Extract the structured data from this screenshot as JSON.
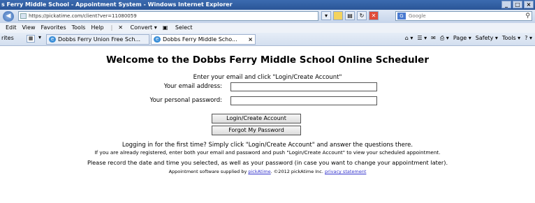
{
  "window": {
    "title": "s Ferry Middle School - Appointment System - Windows Internet Explorer",
    "buttons": [
      "_",
      "□",
      "×"
    ]
  },
  "address_bar": {
    "url": "https://pickatime.com/client?ver=11080059",
    "search_placeholder": "Google"
  },
  "menu": {
    "items": [
      "Edit",
      "View",
      "Favorites",
      "Tools",
      "Help"
    ],
    "extras": [
      "Convert",
      "Select"
    ]
  },
  "tabbar": {
    "favorites_label": "rites",
    "tabs": [
      {
        "label": "Dobbs Ferry Union Free Sch..."
      },
      {
        "label": "Dobbs Ferry Middle Scho..."
      }
    ],
    "commands": [
      "Page ▾",
      "Safety ▾",
      "Tools ▾"
    ]
  },
  "page": {
    "heading": "Welcome to the Dobbs Ferry Middle School Online Scheduler",
    "instruction": "Enter your email and click \"Login/Create Account\"",
    "email_label": "Your email address:",
    "password_label": "Your personal password:",
    "login_button": "Login/Create Account",
    "forgot_button": "Forgot My Password",
    "first_time": "Logging in for the first time? Simply click \"Login/Create Account\" and answer the questions there.",
    "registered": "If you are already registered, enter both your email and password and push \"Login/Create Account\" to view your scheduled appointment.",
    "record": "Please record the date and time you selected, as well as your password (in case you want to change your appointment later).",
    "footer_prefix": "Appointment software supplied by ",
    "footer_link": "pickAtime",
    "footer_mid": ". ©2012 pickAtime Inc. ",
    "footer_privacy": "privacy statement"
  }
}
